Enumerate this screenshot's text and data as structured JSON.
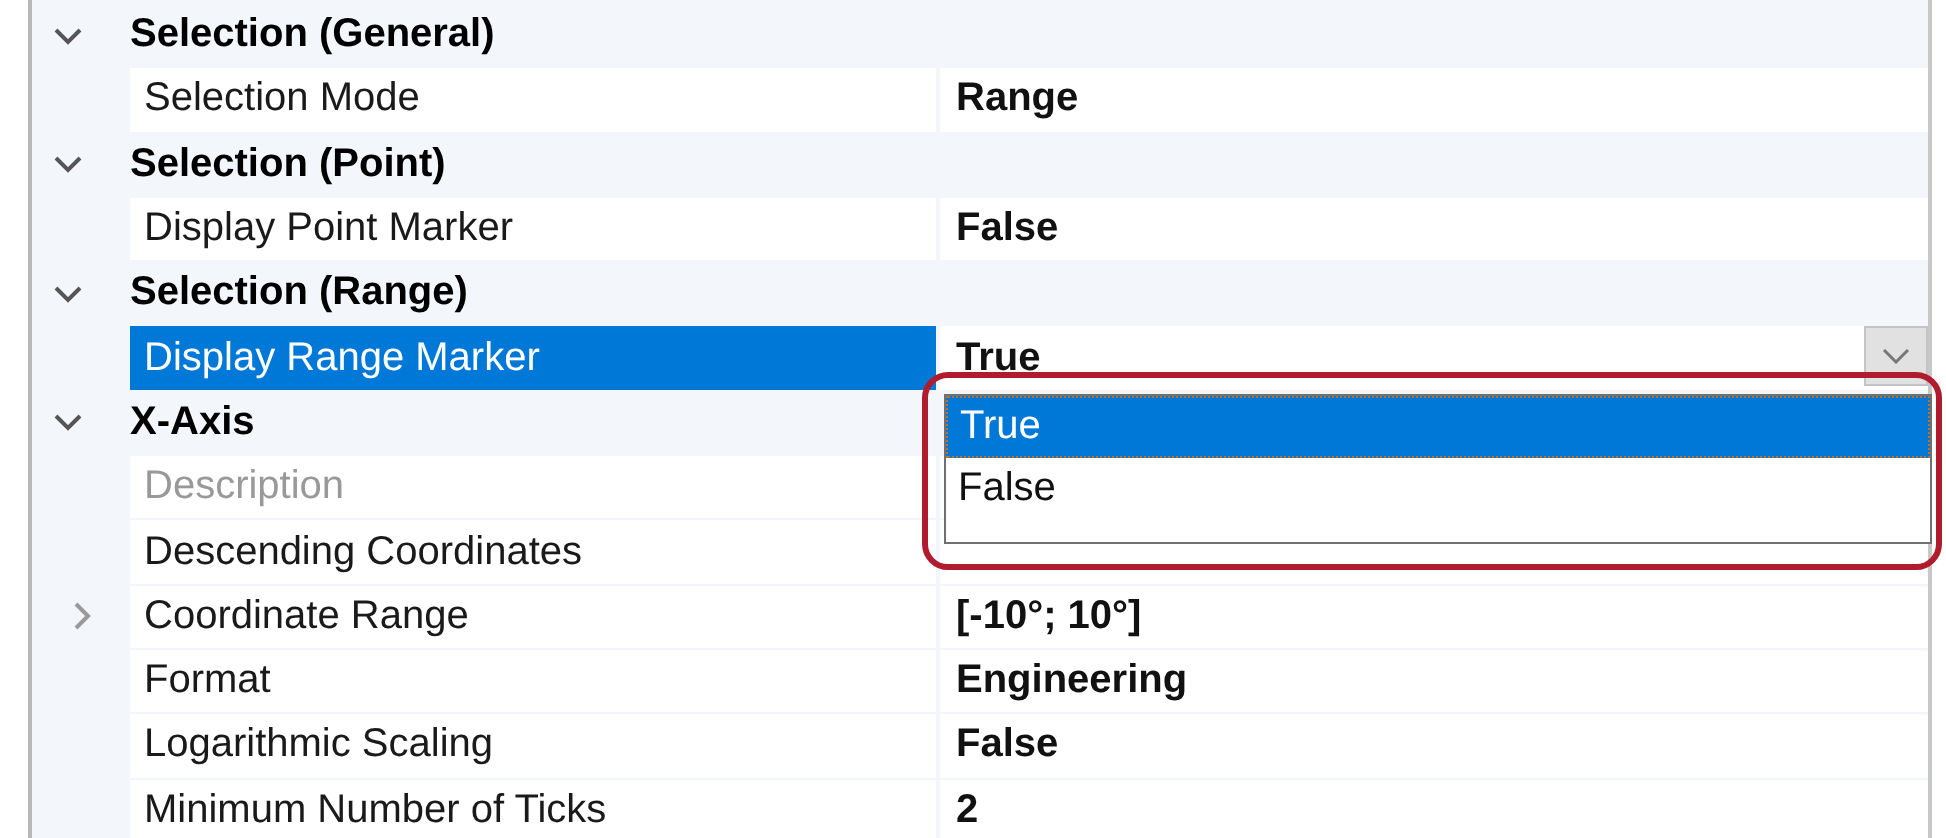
{
  "categories": [
    {
      "title": "Selection (General)",
      "expanded": true,
      "properties": [
        {
          "name": "Selection Mode",
          "value": "Range",
          "disabled": false,
          "expandable": false,
          "selected": false
        }
      ]
    },
    {
      "title": "Selection (Point)",
      "expanded": true,
      "properties": [
        {
          "name": "Display Point Marker",
          "value": "False",
          "disabled": false,
          "expandable": false,
          "selected": false
        }
      ]
    },
    {
      "title": "Selection (Range)",
      "expanded": true,
      "properties": [
        {
          "name": "Display Range Marker",
          "value": "True",
          "disabled": false,
          "expandable": false,
          "selected": true
        }
      ]
    },
    {
      "title": "X-Axis",
      "expanded": true,
      "properties": [
        {
          "name": "Description",
          "disabled": true,
          "expandable": false,
          "selected": false
        },
        {
          "name": "Descending Coordinates",
          "disabled": false,
          "expandable": false,
          "selected": false
        },
        {
          "name": "Coordinate Range",
          "value": "[-10°; 10°]",
          "disabled": false,
          "expandable": true,
          "selected": false
        },
        {
          "name": "Format",
          "value": "Engineering",
          "disabled": false,
          "expandable": false,
          "selected": false
        },
        {
          "name": "Logarithmic Scaling",
          "value": "False",
          "disabled": false,
          "expandable": false,
          "selected": false
        },
        {
          "name": "Minimum Number of Ticks",
          "value": "2",
          "disabled": false,
          "expandable": false,
          "selected": false
        }
      ]
    }
  ],
  "dropdown": {
    "options": [
      {
        "label": "True",
        "selected": true
      },
      {
        "label": "False",
        "selected": false
      }
    ]
  }
}
